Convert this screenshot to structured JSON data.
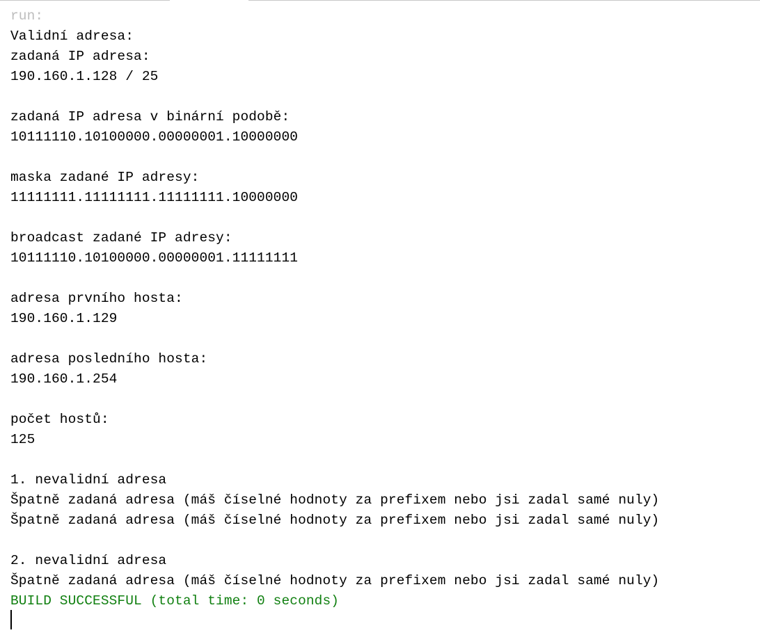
{
  "console": {
    "lines": [
      {
        "type": "run",
        "text": "run:"
      },
      {
        "type": "output",
        "text": "Validní adresa:"
      },
      {
        "type": "output",
        "text": "zadaná IP adresa:"
      },
      {
        "type": "output",
        "text": "190.160.1.128 / 25"
      },
      {
        "type": "blank",
        "text": ""
      },
      {
        "type": "output",
        "text": "zadaná IP adresa v binární podobě:"
      },
      {
        "type": "output",
        "text": "10111110.10100000.00000001.10000000"
      },
      {
        "type": "blank",
        "text": ""
      },
      {
        "type": "output",
        "text": "maska zadané IP adresy:"
      },
      {
        "type": "output",
        "text": "11111111.11111111.11111111.10000000"
      },
      {
        "type": "blank",
        "text": ""
      },
      {
        "type": "output",
        "text": "broadcast zadané IP adresy:"
      },
      {
        "type": "output",
        "text": "10111110.10100000.00000001.11111111"
      },
      {
        "type": "blank",
        "text": ""
      },
      {
        "type": "output",
        "text": "adresa prvního hosta:"
      },
      {
        "type": "output",
        "text": "190.160.1.129"
      },
      {
        "type": "blank",
        "text": ""
      },
      {
        "type": "output",
        "text": "adresa posledního hosta:"
      },
      {
        "type": "output",
        "text": "190.160.1.254"
      },
      {
        "type": "blank",
        "text": ""
      },
      {
        "type": "output",
        "text": "počet hostů:"
      },
      {
        "type": "output",
        "text": "125"
      },
      {
        "type": "blank",
        "text": ""
      },
      {
        "type": "output",
        "text": "1. nevalidní adresa"
      },
      {
        "type": "output",
        "text": "Špatně zadaná adresa (máš číselné hodnoty za prefixem nebo jsi zadal samé nuly)"
      },
      {
        "type": "output",
        "text": "Špatně zadaná adresa (máš číselné hodnoty za prefixem nebo jsi zadal samé nuly)"
      },
      {
        "type": "blank",
        "text": ""
      },
      {
        "type": "output",
        "text": "2. nevalidní adresa"
      },
      {
        "type": "output",
        "text": "Špatně zadaná adresa (máš číselné hodnoty za prefixem nebo jsi zadal samé nuly)"
      },
      {
        "type": "success",
        "text": "BUILD SUCCESSFUL (total time: 0 seconds)"
      }
    ]
  },
  "colors": {
    "run_text": "#bdbdbd",
    "output_text": "#000000",
    "success_text": "#118011",
    "background": "#ffffff"
  }
}
